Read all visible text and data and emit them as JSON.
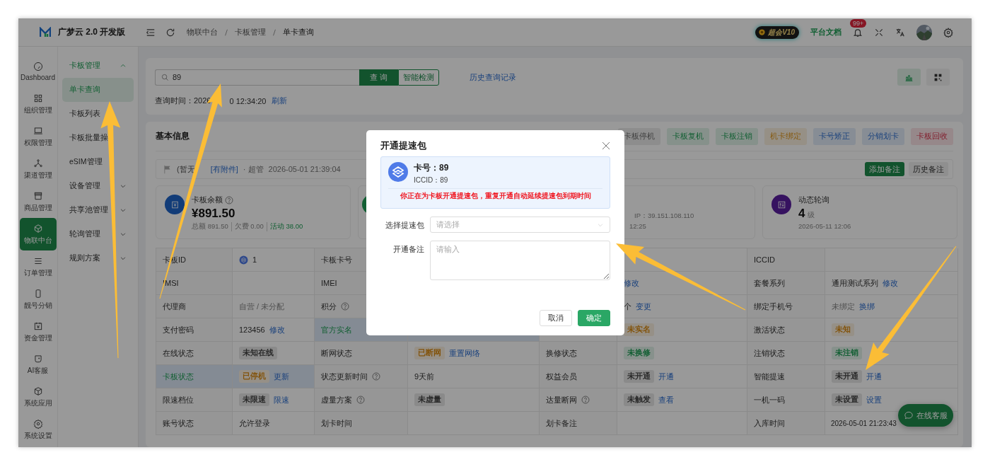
{
  "app": {
    "title": "广梦云 2.0 开发版"
  },
  "breadcrumb": [
    "物联中台",
    "卡板管理",
    "单卡查询"
  ],
  "header_right": {
    "vip_badge": "超会V10",
    "docs_link": "平台文档",
    "notification_count": "99+"
  },
  "rail": [
    {
      "label": "Dashboard",
      "selected": false
    },
    {
      "label": "组织管理",
      "selected": false
    },
    {
      "label": "权限管理",
      "selected": false
    },
    {
      "label": "渠道管理",
      "selected": false
    },
    {
      "label": "商品管理",
      "selected": false
    },
    {
      "label": "物联中台",
      "selected": true
    },
    {
      "label": "订单管理",
      "selected": false
    },
    {
      "label": "靓号分销",
      "selected": false
    },
    {
      "label": "资金管理",
      "selected": false
    },
    {
      "label": "AI客服",
      "selected": false
    },
    {
      "label": "系统应用",
      "selected": false
    },
    {
      "label": "系统设置",
      "selected": false
    }
  ],
  "submenu": [
    {
      "label": "卡板管理",
      "expanded": true,
      "children": [
        {
          "label": "单卡查询",
          "selected": true
        },
        {
          "label": "卡板列表",
          "selected": false
        },
        {
          "label": "卡板批量操",
          "selected": false
        },
        {
          "label": "eSIM管理",
          "selected": false
        }
      ]
    },
    {
      "label": "设备管理",
      "expanded": false
    },
    {
      "label": "共享池管理",
      "expanded": false
    },
    {
      "label": "轮询管理",
      "expanded": false
    },
    {
      "label": "规则方案",
      "expanded": false
    }
  ],
  "search": {
    "value": "89",
    "query_button": "查 询",
    "detect_button": "智能检测",
    "history_link": "历史查询记录",
    "query_time_start": "查询时间：2026",
    "query_time_end": "0 12:34:20",
    "refresh_link": "刷新"
  },
  "detail": {
    "title": "基本信息",
    "actions": [
      {
        "label": "卡板停机",
        "color": "#404040"
      },
      {
        "label": "卡板复机",
        "color": "#125f33"
      },
      {
        "label": "卡板注销",
        "color": "#125f33"
      },
      {
        "label": "机卡绑定",
        "color": "#865a11"
      },
      {
        "label": "卡号矫正",
        "color": "#1c437d"
      },
      {
        "label": "分销划卡",
        "color": "#1c437d"
      },
      {
        "label": "卡板回收",
        "color": "#821f2e"
      }
    ],
    "remark": {
      "text": "(暂无",
      "attachment": "[有附件]",
      "author": "· 超管",
      "time": "2026-05-01 21:39:04",
      "buttons": [
        {
          "label": "添加备注",
          "kind": "primary"
        },
        {
          "label": "历史备注",
          "kind": "default"
        }
      ]
    },
    "stats": [
      {
        "kind": "balance",
        "title": "卡板余额",
        "value": "¥891.50",
        "segments": [
          {
            "text": "总额 891.50",
            "kind": "muted"
          },
          {
            "text": "欠费 0.00",
            "kind": "muted"
          },
          {
            "text": "活动 38.00",
            "kind": "positive"
          }
        ]
      },
      {
        "kind": "hidden"
      },
      {
        "kind": "network",
        "ip": "IP：39.151.108.110",
        "time": "12:25"
      },
      {
        "kind": "polling",
        "title": "动态轮询",
        "value": "4",
        "unit": "级",
        "time": "2026-05-11 12:06"
      }
    ],
    "table": {
      "rows": [
        {
          "cells": [
            {
              "kind": "label",
              "text": "卡板ID",
              "highlighted": false
            },
            {
              "kind": "value",
              "operator": true,
              "text": "1",
              "highlighted": false
            },
            {
              "kind": "label",
              "text": "卡板卡号",
              "highlighted": false
            },
            {
              "kind": "blank"
            },
            {
              "kind": "blank"
            },
            {
              "kind": "blank",
              "highlighted": false
            },
            {
              "kind": "label",
              "text": "ICCID",
              "highlighted": false
            },
            {
              "kind": "blank",
              "highlighted": false
            }
          ]
        },
        {
          "cells": [
            {
              "kind": "label",
              "text": "IMSI",
              "highlighted": false
            },
            {
              "kind": "blank",
              "highlighted": false
            },
            {
              "kind": "label",
              "text": "IMEI",
              "highlighted": false
            },
            {
              "kind": "blank"
            },
            {
              "kind": "blank"
            },
            {
              "kind": "value",
              "link": "修改",
              "highlighted": false
            },
            {
              "kind": "label",
              "text": "套餐系列",
              "highlighted": false
            },
            {
              "kind": "value",
              "text": "通用测试系列",
              "link": "修改",
              "highlighted": false
            }
          ]
        },
        {
          "cells": [
            {
              "kind": "label",
              "text": "代理商",
              "highlighted": false
            },
            {
              "kind": "value",
              "text": "自营 / 未分配",
              "muted": true,
              "highlighted": false
            },
            {
              "kind": "label",
              "text": "积分",
              "help": true,
              "highlighted": false
            },
            {
              "kind": "blank"
            },
            {
              "kind": "blank"
            },
            {
              "kind": "value",
              "text": "个",
              "link": "变更",
              "highlighted": false
            },
            {
              "kind": "label",
              "text": "绑定手机号",
              "highlighted": false
            },
            {
              "kind": "value",
              "text": "未绑定",
              "muted": true,
              "link": "换绑",
              "highlighted": false
            }
          ]
        },
        {
          "cells": [
            {
              "kind": "label",
              "text": "支付密码",
              "highlighted": false
            },
            {
              "kind": "value",
              "text": "123456",
              "link": "修改",
              "highlighted": false
            },
            {
              "kind": "label",
              "text": "官方实名",
              "highlighted": true
            },
            {
              "kind": "blank",
              "highlighted": true
            },
            {
              "kind": "blank",
              "highlighted": false
            },
            {
              "kind": "value",
              "tag": "未实名",
              "color": "#82530b",
              "highlighted": false
            },
            {
              "kind": "label",
              "text": "激活状态",
              "highlighted": false
            },
            {
              "kind": "value",
              "tag": "未知",
              "color": "#82530b",
              "highlighted": false
            }
          ]
        },
        {
          "cells": [
            {
              "kind": "label",
              "text": "在线状态",
              "highlighted": false
            },
            {
              "kind": "value",
              "tag": "未知在线",
              "color": "#292929",
              "highlighted": false
            },
            {
              "kind": "label",
              "text": "断网状态",
              "highlighted": false
            },
            {
              "kind": "value",
              "tag": "已断网",
              "color": "#82530b",
              "link": "重置网络",
              "highlighted": false
            },
            {
              "kind": "label",
              "text": "换修状态",
              "highlighted": false
            },
            {
              "kind": "value",
              "tag": "未换修",
              "color": "#125f33",
              "highlighted": false
            },
            {
              "kind": "label",
              "text": "注销状态",
              "highlighted": false
            },
            {
              "kind": "value",
              "tag": "未注销",
              "color": "#125f33",
              "highlighted": false
            }
          ]
        },
        {
          "cells": [
            {
              "kind": "label",
              "text": "卡板状态",
              "highlighted": true
            },
            {
              "kind": "value",
              "tag": "已停机",
              "color": "#82530b",
              "link": "更新",
              "highlighted": true
            },
            {
              "kind": "label",
              "text": "状态更新时间",
              "help": true,
              "highlighted": false
            },
            {
              "kind": "value",
              "text": "9天前",
              "highlighted": false
            },
            {
              "kind": "label",
              "text": "权益会员",
              "highlighted": false
            },
            {
              "kind": "value",
              "tag": "未开通",
              "color": "#292929",
              "link": "开通",
              "highlighted": false
            },
            {
              "kind": "label",
              "text": "智能提速",
              "highlighted": false
            },
            {
              "kind": "value",
              "tag": "未开通",
              "color": "#292929",
              "link": "开通",
              "highlighted": false
            }
          ]
        },
        {
          "cells": [
            {
              "kind": "label",
              "text": "限速档位",
              "highlighted": false
            },
            {
              "kind": "value",
              "tag": "未限速",
              "color": "#292929",
              "link": "限速",
              "highlighted": false
            },
            {
              "kind": "label",
              "text": "虚量方案",
              "help": true,
              "highlighted": false
            },
            {
              "kind": "value",
              "tag": "未虚量",
              "color": "#292929",
              "highlighted": false
            },
            {
              "kind": "label",
              "text": "达量断网",
              "help": true,
              "highlighted": false
            },
            {
              "kind": "value",
              "tag": "未触发",
              "color": "#292929",
              "link": "查看",
              "highlighted": false
            },
            {
              "kind": "label",
              "text": "一机一码",
              "highlighted": false
            },
            {
              "kind": "value",
              "tag": "未设置",
              "color": "#292929",
              "link": "设置",
              "highlighted": false
            }
          ]
        },
        {
          "cells": [
            {
              "kind": "label",
              "text": "账号状态",
              "highlighted": false
            },
            {
              "kind": "value",
              "text": "允许登录",
              "highlighted": false
            },
            {
              "kind": "label",
              "text": "划卡时间",
              "highlighted": false
            },
            {
              "kind": "blank",
              "highlighted": false
            },
            {
              "kind": "label",
              "text": "划卡备注",
              "highlighted": false
            },
            {
              "kind": "blank",
              "highlighted": false
            },
            {
              "kind": "label",
              "text": "入库时间",
              "highlighted": false
            },
            {
              "kind": "value",
              "text": "2026-05-01 21:23:43",
              "highlighted": false
            }
          ]
        }
      ]
    }
  },
  "dialog": {
    "title": "开通提速包",
    "card_number": "卡号：89",
    "iccid": "ICCID：89",
    "warning": "你正在为卡板开通提速包，重复开通自动延续提速包到期时间",
    "fields": [
      {
        "kind": "select",
        "label": "选择提速包",
        "placeholder": "请选择"
      },
      {
        "kind": "textarea",
        "label": "开通备注",
        "placeholder": "请输入"
      }
    ],
    "buttons": [
      {
        "label": "取消",
        "kind": "default"
      },
      {
        "label": "确定",
        "kind": "primary"
      }
    ]
  },
  "chat_button": "在线客服"
}
